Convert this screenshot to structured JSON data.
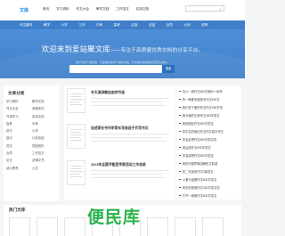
{
  "header": {
    "logo": "文库",
    "nav": [
      "首页",
      "学习资料",
      "作文大全",
      "教学文档",
      "工作范文",
      "实用文档"
    ],
    "search_placeholder": "",
    "search_icon": "search-icon"
  },
  "bluenav": {
    "items": [
      "作文素材",
      "教学",
      "小学",
      "工作",
      "中考",
      "高考",
      "实用",
      "总结",
      "合同",
      "计划",
      "说明"
    ]
  },
  "banner": {
    "title": "欢迎来到爱站聚文库",
    "subtitle": "——专注于高质量优秀文档的分享平台。",
    "description": "用户免费下载阅读：汇集各学段学习资料文档、作文素材及各类实用范文资料。",
    "search_button": "搜索"
  },
  "categories": {
    "title": "文库分类",
    "items": [
      "学习资料",
      "教学文档",
      "作文大全",
      "资格考试",
      "外语学习",
      "实用文档",
      "高考",
      "中考",
      "初中",
      "小学",
      "高中",
      "计划总结",
      "范文",
      "党团资料",
      "合同",
      "工作范文",
      "论文",
      "法律文书",
      "幼儿教育",
      "公文"
    ]
  },
  "docs": [
    {
      "title": "冬天演讲稿自由的节选"
    },
    {
      "title": "自述家长书作学家长写给孩子代写作文"
    },
    {
      "title": "2023年全国节能宣传周活动工作总结"
    }
  ],
  "list": {
    "items": [
      "请以一篇作文600字满分一篇作",
      "有一种爱叫做放手作文600字",
      "我们关于爱的作文作文450字范",
      "我与我的生命作文450字范文",
      "我的朋友作文500字范文",
      "初中生的我记作文作文高中作文",
      "学会反思作文600字范文初",
      "读后感作文600字范文",
      "学会感恩作文600字范文",
      "我的中国梦演讲稿范文精选",
      "初二写景的作文3篇范文",
      "以爱为话题作文600字范文",
      "成长的烦恼作文400字范文初",
      "打开一扇窗作文600字范文"
    ]
  },
  "hot": {
    "title": "热门文库"
  },
  "watermark": {
    "text": "便民库"
  },
  "colors": {
    "brand_blue": "#3f7fca",
    "accent_red": "#c9302c",
    "watermark_green": "#29b34b"
  }
}
